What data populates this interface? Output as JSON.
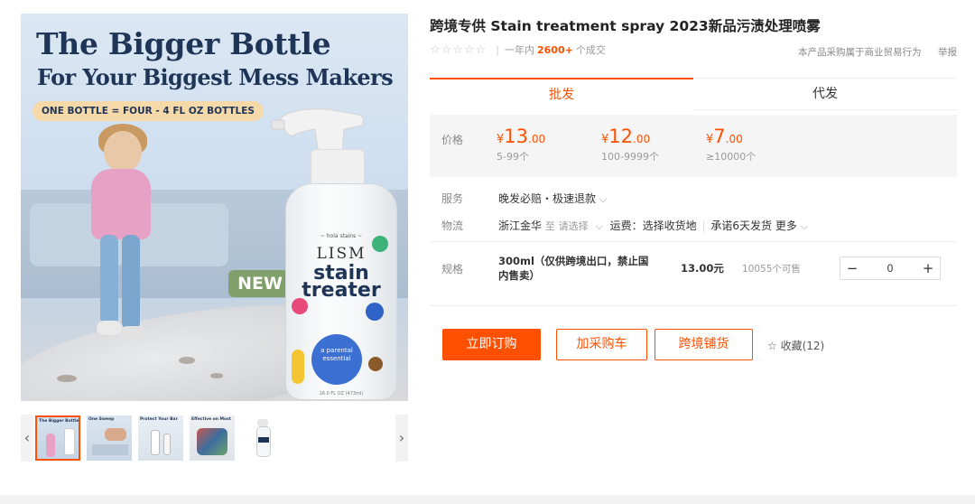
{
  "gallery": {
    "banner_title": "The Bigger Bottle",
    "banner_subtitle": "For Your Biggest Mess Makers",
    "banner_pill": "ONE BOTTLE = FOUR - 4 FL OZ BOTTLES",
    "new_badge": "NEW",
    "bottle_small": "~ hola stains ~",
    "bottle_brand": "LISM",
    "bottle_product": "stain treater",
    "bottle_circle": "a parental essential",
    "bottle_volume": "16.0 FL OZ (473ml)",
    "thumb_captions": [
      "The Bigger Bottle",
      "One Sweep",
      "Protect Your Bar",
      "Effective on Most"
    ],
    "arrow_left": "‹",
    "arrow_right": "›"
  },
  "product": {
    "title": "跨境专供 Stain treatment spray 2023新品污渍处理喷雾",
    "stars": "☆☆☆☆☆",
    "sold_prefix": "一年内",
    "sold_count": "2600+",
    "sold_suffix": "个成交",
    "notice": "本产品采购属于商业贸易行为",
    "report": "举报"
  },
  "tabs": {
    "wholesale": "批发",
    "dropship": "代发"
  },
  "pricing": {
    "label": "价格",
    "tiers": [
      {
        "currency": "¥",
        "integer": "13",
        "decimal": ".00",
        "range": "5-99个"
      },
      {
        "currency": "¥",
        "integer": "12",
        "decimal": ".00",
        "range": "100-9999个"
      },
      {
        "currency": "¥",
        "integer": "7",
        "decimal": ".00",
        "range": "≥10000个"
      }
    ]
  },
  "service": {
    "label": "服务",
    "value": "晚发必赔・极速退款",
    "chevron": "⌵"
  },
  "logistics": {
    "label": "物流",
    "origin": "浙江金华",
    "to": "至",
    "choose": "请选择",
    "chevron": "⌵",
    "freight": "运费：选择收货地",
    "promise": "承诺6天发货",
    "more": "更多"
  },
  "spec": {
    "label": "规格",
    "name": "300ml（仅供跨境出口，禁止国内售卖）",
    "price": "13.00元",
    "stock": "10055个可售",
    "quantity": "0",
    "minus": "−",
    "plus": "+"
  },
  "actions": {
    "order": "立即订购",
    "add_cart": "加采购车",
    "cross_border": "跨境铺货",
    "favorite_icon": "☆",
    "favorite": "收藏(12)"
  },
  "colors": {
    "accent": "#ff5000",
    "navy": "#1f3557"
  }
}
